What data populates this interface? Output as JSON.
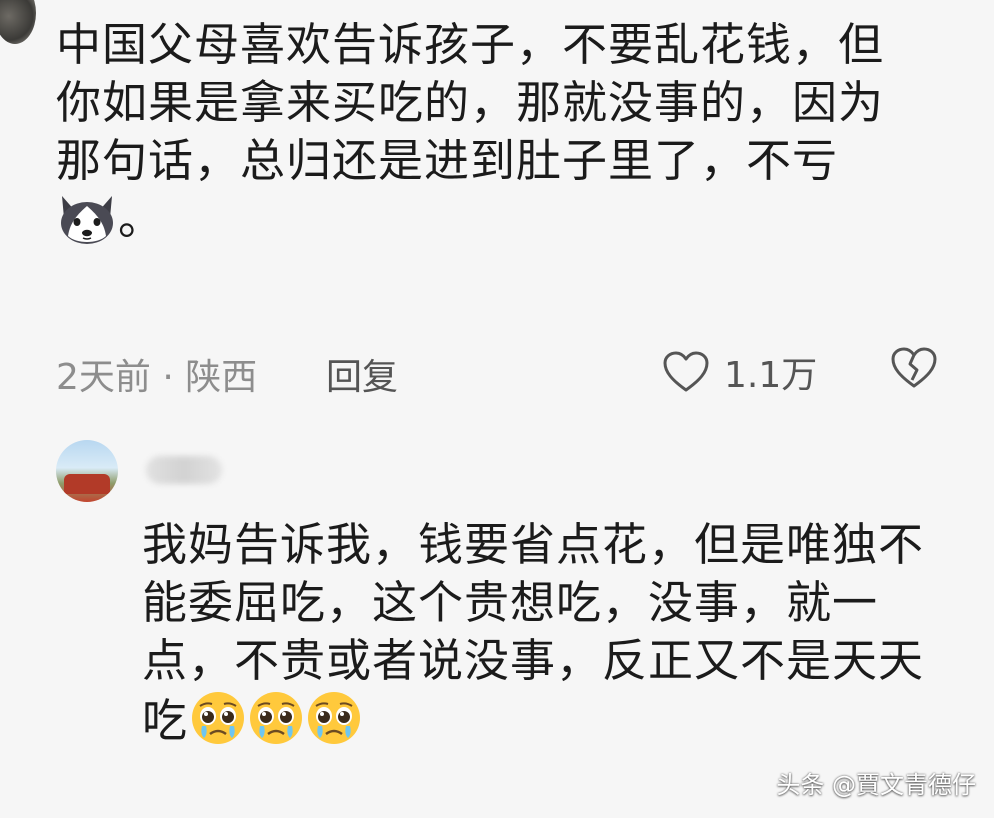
{
  "comment": {
    "lines": [
      "中国父母喜欢告诉孩子，不要乱花钱，但",
      "你如果是拿来买吃的，那就没事的，因为",
      "那句话，总归还是进到肚子里了，不亏"
    ],
    "end_emoji": "husky-icon",
    "end_punct": "。",
    "meta": {
      "time_location": "2天前 · 陕西",
      "reply_label": "回复",
      "like_count": "1.1万"
    }
  },
  "reply": {
    "lines": [
      "我妈告诉我，钱要省点花，但是唯独不",
      "能委屈吃，这个贵想吃，没事，就一",
      "点，不贵或者说没事，反正又不是天天",
      "吃"
    ],
    "emojis": [
      "pleading-crying-icon",
      "pleading-crying-icon",
      "pleading-crying-icon"
    ]
  },
  "watermark": "头条 @賈文青德仔",
  "colors": {
    "background": "#f6f6f6",
    "text": "#1b1b1b",
    "meta": "#8d8d8d",
    "emoji_yellow": "#ffc93c"
  }
}
